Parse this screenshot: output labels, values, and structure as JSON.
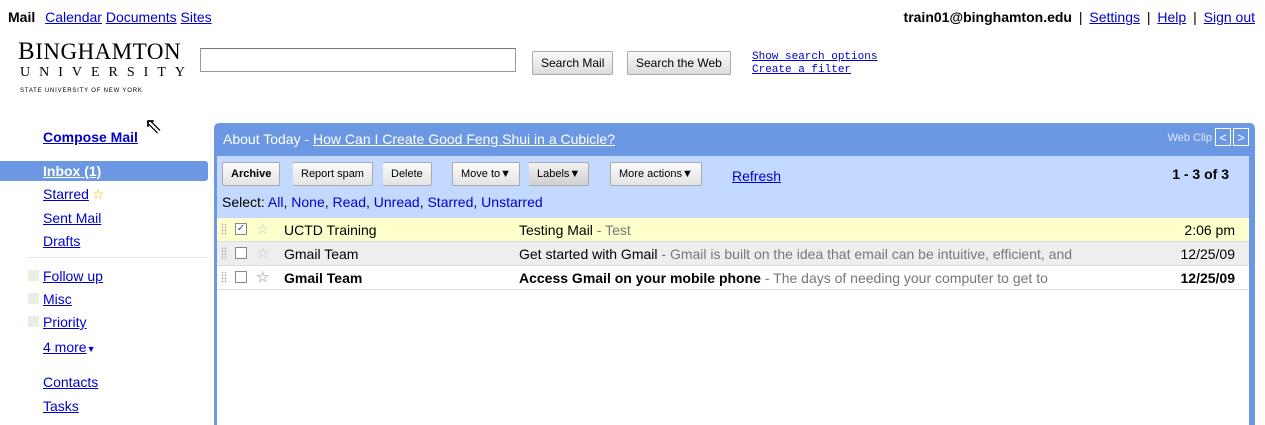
{
  "topnav": {
    "mail": "Mail",
    "calendar": "Calendar",
    "documents": "Documents",
    "sites": "Sites"
  },
  "account": {
    "user": "train01@binghamton.edu",
    "settings": "Settings",
    "help": "Help",
    "signout": "Sign out",
    "sep": "|"
  },
  "logo": {
    "line1_first": "B",
    "line1_rest": "INGHAMTON",
    "line2": "UNIVERSITY",
    "line3": "STATE UNIVERSITY OF NEW YORK"
  },
  "search": {
    "value": "",
    "search_mail": "Search Mail",
    "search_web": "Search the Web",
    "show_options": "Show search options",
    "create_filter": "Create a filter"
  },
  "sidebar": {
    "compose": "Compose Mail",
    "inbox": "Inbox (1)",
    "starred": "Starred",
    "sent": "Sent Mail",
    "drafts": "Drafts",
    "labels": [
      "Follow up",
      "Misc",
      "Priority"
    ],
    "more": "4 more",
    "contacts": "Contacts",
    "tasks": "Tasks"
  },
  "webclip": {
    "prefix": "About Today - ",
    "link": "How Can I Create Good Feng Shui in a Cubicle?",
    "label": "Web Clip",
    "prev": "<",
    "next": ">"
  },
  "toolbar": {
    "archive": "Archive",
    "spam": "Report spam",
    "delete": "Delete",
    "moveto": "Move to▼",
    "labels": "Labels▼",
    "more": "More actions▼",
    "refresh": "Refresh",
    "pager": "1 - 3 of 3",
    "select_prefix": "Select: ",
    "select": [
      "All",
      "None",
      "Read",
      "Unread",
      "Starred",
      "Unstarred"
    ]
  },
  "messages": [
    {
      "sender": "UCTD Training",
      "subject": "Testing Mail",
      "snippet": " - Test",
      "date": "2:06 pm",
      "checked": "✓"
    },
    {
      "sender": "Gmail Team",
      "subject": "Get started with Gmail",
      "snippet": " - Gmail is built on the idea that email can be intuitive, efficient, and",
      "date": "12/25/09",
      "checked": ""
    },
    {
      "sender": "Gmail Team",
      "subject": "Access Gmail on your mobile phone",
      "snippet": " - The days of needing your computer to get to",
      "date": "12/25/09",
      "checked": ""
    }
  ],
  "colors": {
    "accent": "#6b97e3",
    "toolbar_bg": "#c3d9ff",
    "selected_row": "#ffffcc",
    "link": "#0000cc"
  }
}
